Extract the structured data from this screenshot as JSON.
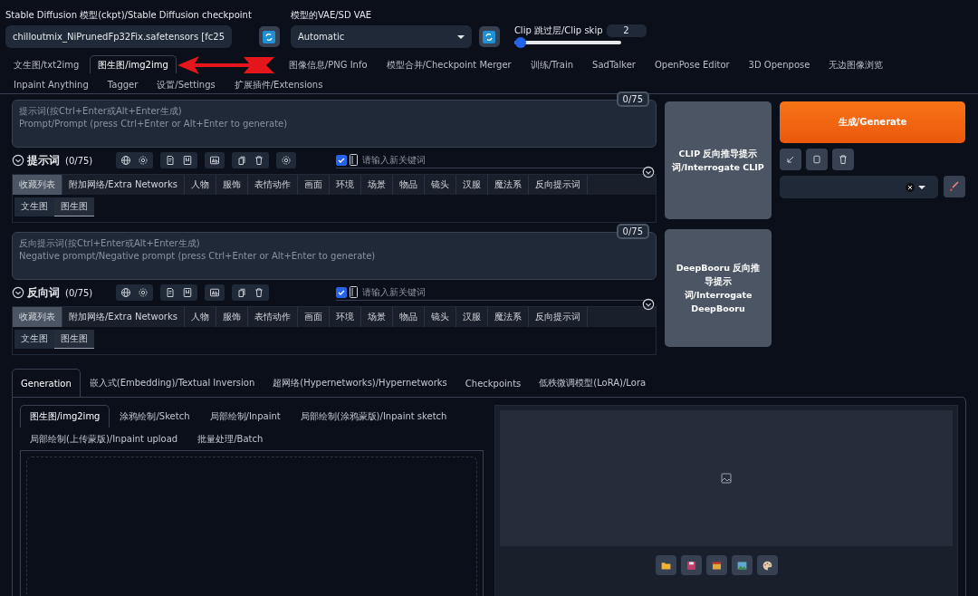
{
  "checkpoint": {
    "label": "Stable Diffusion 模型(ckpt)/Stable Diffusion checkpoint",
    "value": "chilloutmix_NiPrunedFp32Fix.safetensors [fc25"
  },
  "vae": {
    "label": "模型的VAE/SD VAE",
    "value": "Automatic"
  },
  "clip_skip": {
    "label": "Clip 跳过层/Clip skip",
    "value": "2",
    "level": 0.06
  },
  "main_tabs": [
    {
      "label": "文生图/txt2img",
      "selected": false
    },
    {
      "label": "图生图/img2img",
      "selected": true
    },
    {
      "label": "图像信息/PNG Info",
      "selected": false
    },
    {
      "label": "模型合并/Checkpoint Merger",
      "selected": false
    },
    {
      "label": "训练/Train",
      "selected": false
    },
    {
      "label": "SadTalker",
      "selected": false
    },
    {
      "label": "OpenPose Editor",
      "selected": false
    },
    {
      "label": "3D Openpose",
      "selected": false
    },
    {
      "label": "无边图像浏览",
      "selected": false
    },
    {
      "label": "Inpaint Anything",
      "selected": false
    },
    {
      "label": "Tagger",
      "selected": false
    },
    {
      "label": "设置/Settings",
      "selected": false
    },
    {
      "label": "扩展插件/Extensions",
      "selected": false
    }
  ],
  "prompts": [
    {
      "placeholder": "提示词(按Ctrl+Enter或Alt+Enter生成)\nPrompt/Prompt (press Ctrl+Enter or Alt+Enter to generate)",
      "counter": "0/75",
      "title": "提示词",
      "count": "(0/75)",
      "keyword_placeholder": "请输入新关键词",
      "keyword_enabled": true,
      "tool_groups": [
        [
          {
            "kind": "globe"
          },
          {
            "kind": "gear"
          }
        ],
        [
          {
            "kind": "document"
          },
          {
            "kind": "bookmark"
          }
        ],
        [
          {
            "kind": "letters"
          }
        ],
        [
          {
            "kind": "copy"
          },
          {
            "kind": "trash"
          }
        ],
        [
          {
            "kind": "gear"
          }
        ]
      ],
      "categories": [
        {
          "label": "收藏列表",
          "selected": true
        },
        {
          "label": "附加网络/Extra Networks",
          "selected": false
        },
        {
          "label": "人物",
          "selected": false
        },
        {
          "label": "服饰",
          "selected": false
        },
        {
          "label": "表情动作",
          "selected": false
        },
        {
          "label": "画面",
          "selected": false
        },
        {
          "label": "环境",
          "selected": false
        },
        {
          "label": "场景",
          "selected": false
        },
        {
          "label": "物品",
          "selected": false
        },
        {
          "label": "镜头",
          "selected": false
        },
        {
          "label": "汉服",
          "selected": false
        },
        {
          "label": "魔法系",
          "selected": false
        },
        {
          "label": "反向提示词",
          "selected": false
        }
      ],
      "sub_tabs": [
        {
          "label": "文生图",
          "selected": false
        },
        {
          "label": "图生图",
          "selected": true
        }
      ]
    },
    {
      "placeholder": "反向提示词(按Ctrl+Enter或Alt+Enter生成)\nNegative prompt/Negative prompt (press Ctrl+Enter or Alt+Enter to generate)",
      "counter": "0/75",
      "title": "反向词",
      "count": "(0/75)",
      "keyword_placeholder": "请输入新关键词",
      "keyword_enabled": true,
      "tool_groups": [
        [
          {
            "kind": "globe"
          },
          {
            "kind": "gear"
          }
        ],
        [
          {
            "kind": "document"
          },
          {
            "kind": "bookmark"
          }
        ],
        [
          {
            "kind": "letters"
          }
        ],
        [
          {
            "kind": "copy"
          },
          {
            "kind": "trash"
          }
        ]
      ],
      "categories": [
        {
          "label": "收藏列表",
          "selected": true
        },
        {
          "label": "附加网络/Extra Networks",
          "selected": false
        },
        {
          "label": "人物",
          "selected": false
        },
        {
          "label": "服饰",
          "selected": false
        },
        {
          "label": "表情动作",
          "selected": false
        },
        {
          "label": "画面",
          "selected": false
        },
        {
          "label": "环境",
          "selected": false
        },
        {
          "label": "场景",
          "selected": false
        },
        {
          "label": "物品",
          "selected": false
        },
        {
          "label": "镜头",
          "selected": false
        },
        {
          "label": "汉服",
          "selected": false
        },
        {
          "label": "魔法系",
          "selected": false
        },
        {
          "label": "反向提示词",
          "selected": false
        }
      ],
      "sub_tabs": [
        {
          "label": "文生图",
          "selected": false
        },
        {
          "label": "图生图",
          "selected": true
        }
      ]
    }
  ],
  "interrogate_buttons": [
    "CLIP 反向推导提示词/Interrogate CLIP",
    "DeepBooru 反向推导提示词/Interrogate DeepBooru"
  ],
  "generate_button": "生成/Generate",
  "tool_buttons": [
    {
      "kind": "arrow"
    },
    {
      "kind": "square"
    },
    {
      "kind": "trash"
    }
  ],
  "bottom_tabs": [
    {
      "label": "Generation",
      "selected": true
    },
    {
      "label": "嵌入式(Embedding)/Textual Inversion",
      "selected": false
    },
    {
      "label": "超网络(Hypernetworks)/Hypernetworks",
      "selected": false
    },
    {
      "label": "Checkpoints",
      "selected": false
    },
    {
      "label": "低秩微调模型(LoRA)/Lora",
      "selected": false
    }
  ],
  "image_tabs": [
    {
      "label": "图生图/img2img",
      "selected": true
    },
    {
      "label": "涂鸦绘制/Sketch",
      "selected": false
    },
    {
      "label": "局部绘制/Inpaint",
      "selected": false
    },
    {
      "label": "局部绘制(涂鸦蒙版)/Inpaint sketch",
      "selected": false
    },
    {
      "label": "局部绘制(上传蒙版)/Inpaint upload",
      "selected": false
    },
    {
      "label": "批量处理/Batch",
      "selected": false
    }
  ],
  "output_tools": [
    {
      "kind": "folder"
    },
    {
      "kind": "save"
    },
    {
      "kind": "archive"
    },
    {
      "kind": "image"
    },
    {
      "kind": "palette"
    }
  ]
}
